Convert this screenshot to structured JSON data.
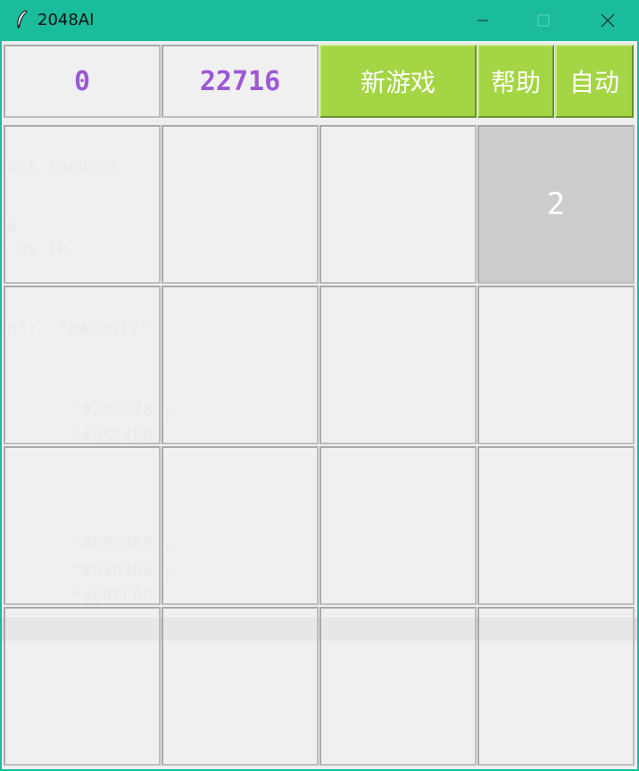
{
  "window": {
    "title": "2048AI"
  },
  "header": {
    "score": "0",
    "best": "22716",
    "new_game_label": "新游戏",
    "help_label": "帮助",
    "auto_label": "自动"
  },
  "board": {
    "rows": [
      [
        "",
        "",
        "",
        "2"
      ],
      [
        "",
        "",
        "",
        ""
      ],
      [
        "",
        "",
        "",
        ""
      ],
      [
        "",
        "",
        "",
        ""
      ]
    ]
  },
  "background_code": [
    "port randint",
    "ng",
    "r as tk",
    "wn\":  \"#ADD817\",",
    "\"#282828\",",
    "\"#9554E0\",",
    "\"#C9C9C9\",",
    "\"#03D385\",",
    "\"#E8EE8B\","
  ],
  "colors": {
    "titlebar": "#1abc9c",
    "button_green": "#a4d544",
    "score_purple": "#9b59d6",
    "tile_2": "#cccccc",
    "empty_cell": "#efefef"
  },
  "icons": {
    "app": "feather-icon",
    "minimize": "minimize-icon",
    "maximize": "maximize-icon",
    "close": "close-icon"
  }
}
